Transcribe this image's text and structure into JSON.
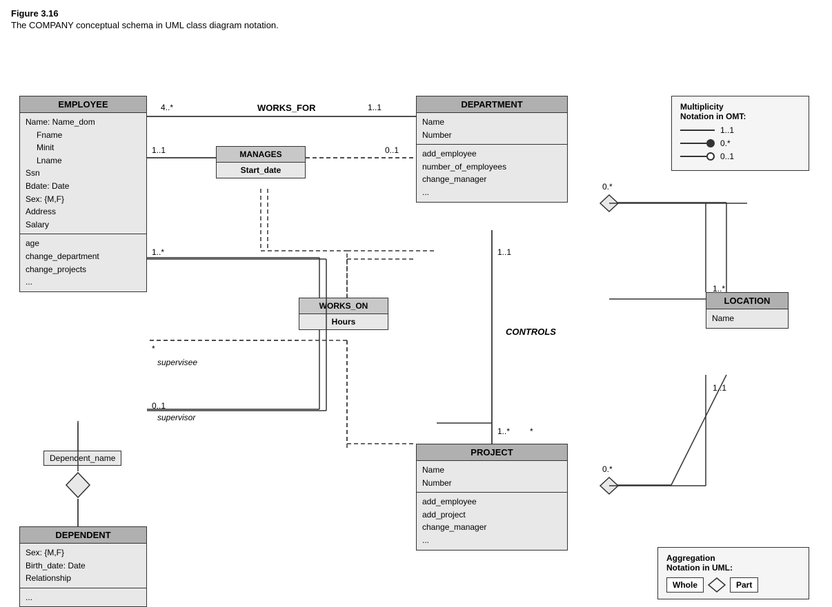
{
  "figure": {
    "title": "Figure 3.16",
    "caption": "The COMPANY conceptual schema in UML class diagram notation."
  },
  "classes": {
    "employee": {
      "header": "EMPLOYEE",
      "attributes": [
        "Name: Name_dom",
        "  Fname",
        "  Minit",
        "  Lname",
        "Ssn",
        "Bdate: Date",
        "Sex: {M,F}",
        "Address",
        "Salary"
      ],
      "methods": [
        "age",
        "change_department",
        "change_projects",
        "..."
      ]
    },
    "department": {
      "header": "DEPARTMENT",
      "attributes": [
        "Name",
        "Number"
      ],
      "methods": [
        "add_employee",
        "number_of_employees",
        "change_manager",
        "..."
      ]
    },
    "project": {
      "header": "PROJECT",
      "attributes": [
        "Name",
        "Number"
      ],
      "methods": [
        "add_employee",
        "add_project",
        "change_manager",
        "..."
      ]
    },
    "location": {
      "header": "LOCATION",
      "attributes": [
        "Name"
      ],
      "methods": []
    },
    "dependent": {
      "header": "DEPENDENT",
      "attributes": [
        "Sex: {M,F}",
        "Birth_date: Date",
        "Relationship"
      ],
      "methods": [
        "..."
      ]
    }
  },
  "associations": {
    "manages": {
      "header": "MANAGES",
      "body": "Start_date"
    },
    "works_on": {
      "header": "WORKS_ON",
      "body": "Hours"
    },
    "works_for": "WORKS_FOR",
    "controls": "CONTROLS"
  },
  "multiplicities": {
    "works_for_left": "4..*",
    "works_for_right": "1..1",
    "manages_left": "1..1",
    "manages_right": "0..1",
    "supervises_top": "1..*",
    "supervises_star": "*",
    "supervisee": "supervisee",
    "supervisor": "supervisor",
    "controls_dept": "1..1",
    "controls_proj": "1..*",
    "works_on_star": "*",
    "dept_location": "0.*",
    "location_top": "1..*",
    "location_bottom": "1..1",
    "proj_location": "0.*",
    "dependent_name": "Dependent_name"
  },
  "notation": {
    "title_line1": "Multiplicity",
    "title_line2": "Notation in OMT:",
    "rows": [
      {
        "label": "1..1",
        "type": "line"
      },
      {
        "label": "0.*",
        "type": "dot"
      },
      {
        "label": "0..1",
        "type": "open"
      }
    ]
  },
  "aggregation": {
    "title_line1": "Aggregation",
    "title_line2": "Notation in UML:",
    "whole_label": "Whole",
    "part_label": "Part"
  }
}
